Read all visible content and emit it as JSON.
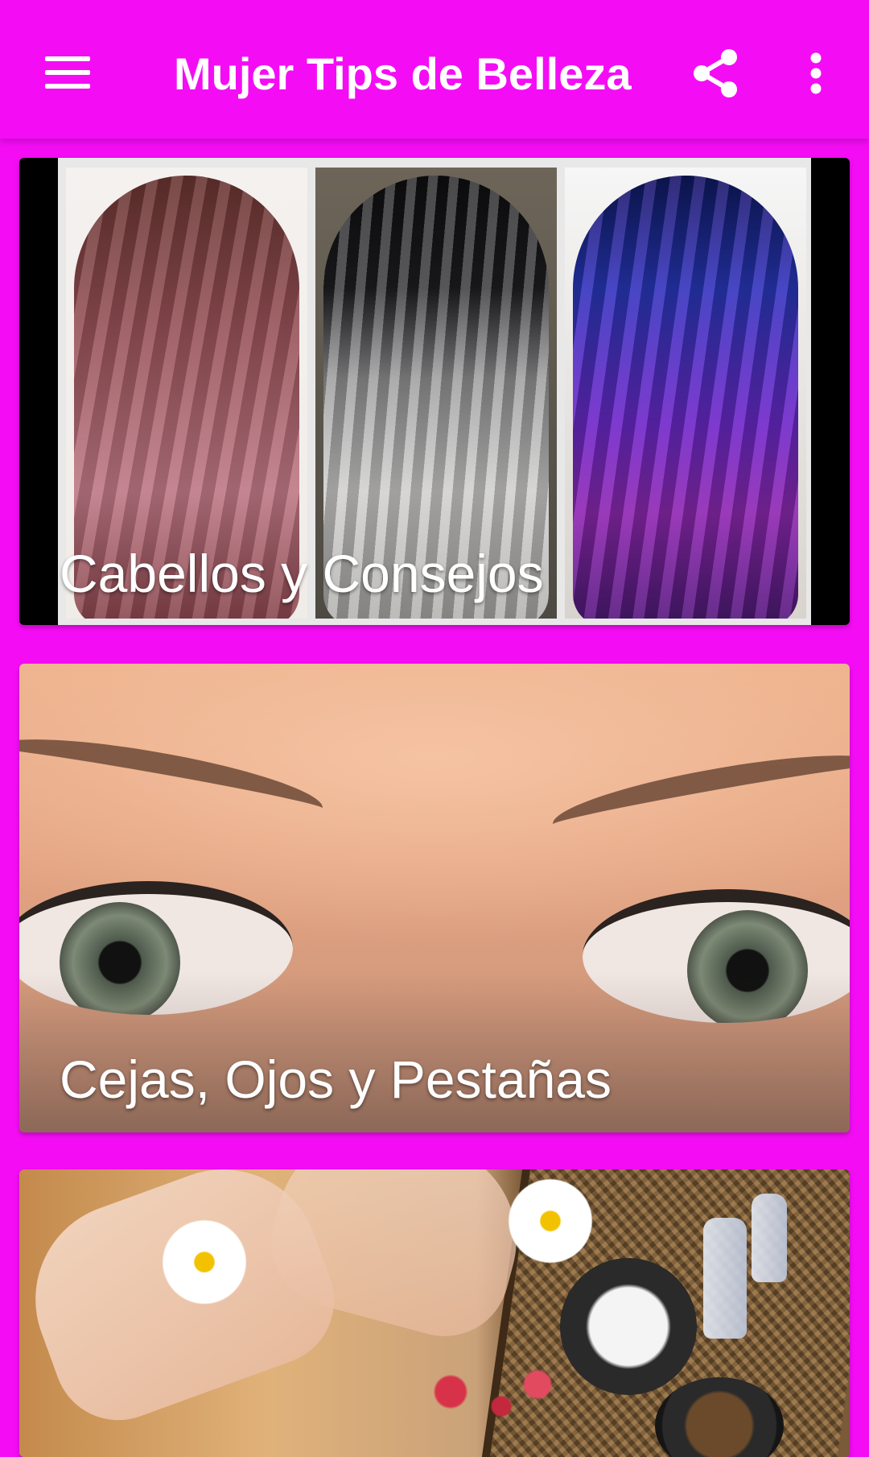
{
  "app_bar": {
    "title": "Mujer Tips de Belleza",
    "menu_icon": "hamburger-menu-icon",
    "share_icon": "share-icon",
    "overflow_icon": "more-vert-icon",
    "background_color": "#f40df4",
    "text_color": "#ffffff"
  },
  "categories": [
    {
      "label": "Cabellos y Consejos"
    },
    {
      "label": "Cejas, Ojos y Pestañas"
    },
    {
      "label": ""
    }
  ]
}
